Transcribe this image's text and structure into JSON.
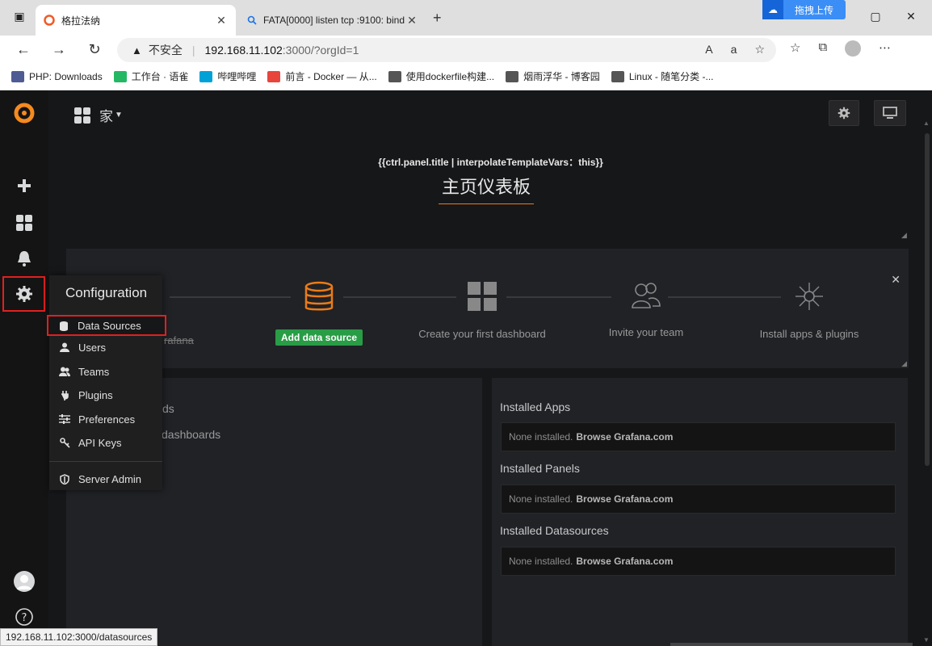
{
  "browser": {
    "tabs": [
      {
        "title": "格拉法纳",
        "active": true
      },
      {
        "title": "FATA[0000] listen tcp :9100: bind",
        "active": false
      }
    ],
    "cloud_badge": "拖拽上传",
    "address": {
      "security": "不安全",
      "host": "192.168.11.102",
      "path": ":3000/?orgId=1"
    },
    "bookmarks": [
      {
        "label": "PHP: Downloads",
        "color": "#4f5b93"
      },
      {
        "label": "工作台 · 语雀",
        "color": "#25b864"
      },
      {
        "label": "哔哩哔哩",
        "color": "#00a1d6"
      },
      {
        "label": "前言 - Docker — 从...",
        "color": "#e8453c"
      },
      {
        "label": "使用dockerfile构建...",
        "color": "#555555"
      },
      {
        "label": "烟雨浮华 - 博客园",
        "color": "#555555"
      },
      {
        "label": "Linux - 随笔分类 -...",
        "color": "#555555"
      }
    ],
    "status_url": "192.168.11.102:3000/datasources"
  },
  "grafana": {
    "dashboard_title": "家",
    "panel_template_text": "{{ctrl.panel.title | interpolateTemplateVars：this}}",
    "panel_title": "主页仪表板",
    "getting_started": {
      "steps": [
        {
          "label": "Install Grafana"
        },
        {
          "label": "Add data source",
          "button": true
        },
        {
          "label": "Create your first dashboard"
        },
        {
          "label": "Invite your team"
        },
        {
          "label": "Install apps & plugins"
        }
      ],
      "partial_first_label": "rafana"
    },
    "left_panel": {
      "partial_lines": [
        "ds",
        "dashboards"
      ]
    },
    "right_panel": {
      "sections": [
        {
          "title": "Installed Apps",
          "empty_text": "None installed.",
          "link": "Browse Grafana.com"
        },
        {
          "title": "Installed Panels",
          "empty_text": "None installed.",
          "link": "Browse Grafana.com"
        },
        {
          "title": "Installed Datasources",
          "empty_text": "None installed.",
          "link": "Browse Grafana.com"
        }
      ]
    },
    "config_menu": {
      "header": "Configuration",
      "items": [
        {
          "label": "Data Sources",
          "icon": "database-icon",
          "selected": true
        },
        {
          "label": "Users",
          "icon": "user-icon"
        },
        {
          "label": "Teams",
          "icon": "users-icon"
        },
        {
          "label": "Plugins",
          "icon": "plug-icon"
        },
        {
          "label": "Preferences",
          "icon": "sliders-icon"
        },
        {
          "label": "API Keys",
          "icon": "key-icon"
        },
        {
          "label": "Server Admin",
          "icon": "shield-icon"
        }
      ]
    },
    "accent_color": "#eb7b18",
    "success_color": "#299c46"
  }
}
